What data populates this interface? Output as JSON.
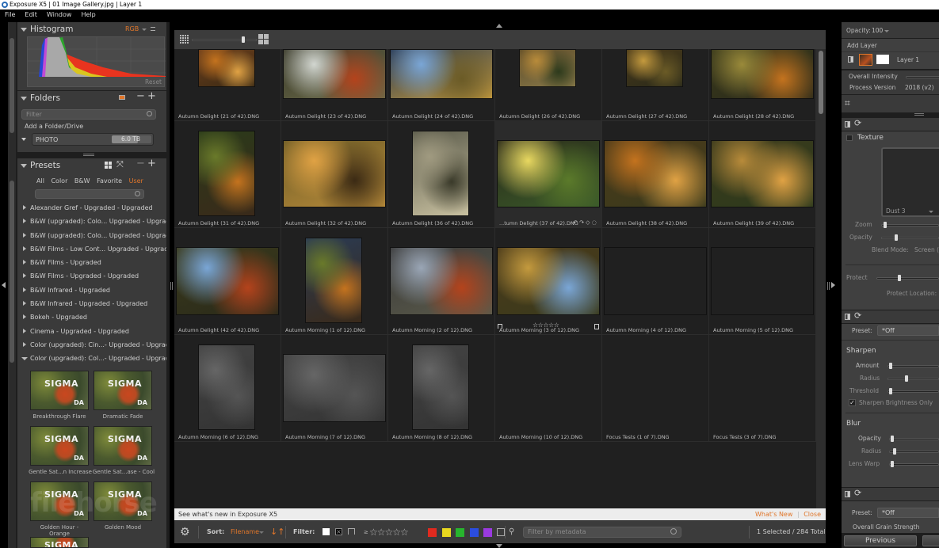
{
  "window": {
    "title": "Exposure X5 | 01 Image Gallery.jpg | Layer 1"
  },
  "menu": [
    "File",
    "Edit",
    "Window",
    "Help"
  ],
  "left_panel": {
    "histogram": {
      "title": "Histogram",
      "channel": "RGB",
      "reset_label": "Reset"
    },
    "folders": {
      "title": "Folders",
      "filter_placeholder": "Filter",
      "add_label": "Add a Folder/Drive",
      "drive": {
        "name": "PHOTO",
        "size": "6.0 TB",
        "used_fraction": 0.65
      }
    },
    "presets": {
      "title": "Presets",
      "tabs": [
        "All",
        "Color",
        "B&W",
        "Favorite",
        "User"
      ],
      "active_tab": "User",
      "items": [
        "Alexander Gref - Upgraded - Upgraded",
        "B&W (upgraded): Colo... Upgraded - Upgraded",
        "B&W (upgraded): Colo... Upgraded - Upgraded",
        "B&W Films - Low Cont... Upgraded - Upgraded",
        "B&W Films - Upgraded",
        "B&W Films - Upgraded - Upgraded",
        "B&W Infrared - Upgraded",
        "B&W Infrared - Upgraded - Upgraded",
        "Bokeh - Upgraded",
        "Cinema - Upgraded - Upgraded",
        "Color (upgraded): Cin...- Upgraded - Upgraded",
        "Color (upgraded): Col...- Upgraded - Upgraded"
      ],
      "thumb_text": {
        "brand": "SIGMA",
        "badge": "DA"
      },
      "thumbnails": [
        "Breakthrough Flare",
        "Dramatic Fade",
        "Gentle Sat...n Increase",
        "Gentle Sat...ase - Cool",
        "Golden Hour - Orange",
        "Golden Mood",
        ""
      ]
    }
  },
  "center": {
    "thumb_size_fraction": 0.8,
    "rows": [
      [
        "Autumn Delight (21 of 42).DNG",
        "Autumn Delight (23 of 42).DNG",
        "Autumn Delight (24 of 42).DNG",
        "Autumn Delight (26 of 42).DNG",
        "Autumn Delight (27 of 42).DNG",
        "Autumn Delight (28 of 42).DNG"
      ],
      [
        "Autumn Delight (31 of 42).DNG",
        "Autumn Delight (32 of 42).DNG",
        "Autumn Delight (36 of 42).DNG",
        "...tumn Delight (37 of 42).DNG",
        "Autumn Delight (38 of 42).DNG",
        "Autumn Delight (39 of 42).DNG"
      ],
      [
        "Autumn Delight (42 of 42).DNG",
        "Autumn Morning (1 of 12).DNG",
        "Autumn Morning (2 of 12).DNG",
        "Autumn Morning (3 of 12).DNG",
        "Autumn Morning (4 of 12).DNG",
        "Autumn Morning (5 of 12).DNG"
      ],
      [
        "Autumn Morning (6 of 12).DNG",
        "Autumn Morning (7 of 12).DNG",
        "Autumn Morning (8 of 12).DNG",
        "Autumn Morning (10 of 12).DNG",
        "Focus Tests (1 of 7).DNG",
        "Focus Tests (3 of 7).DNG"
      ]
    ],
    "selected": "Autumn Delight (37 of 42).DNG",
    "selected_rating": 0,
    "notice": {
      "text": "See what's new in Exposure X5",
      "whats_new": "What's New",
      "close": "Close"
    },
    "bottom": {
      "sort_label": "Sort:",
      "sort_value": "Filename",
      "filter_label": "Filter:",
      "rating_prefix": "≥",
      "color_labels": [
        "#e02a1f",
        "#e8d81f",
        "#27b52e",
        "#2b4de0",
        "#9a3ae0"
      ],
      "metadata_placeholder": "Filter by metadata",
      "count": "1 Selected / 284 Total"
    }
  },
  "right_panel": {
    "opacity_label": "Opacity:",
    "opacity_value": "100",
    "add_layer": "Add Layer",
    "layer_name": "Layer 1",
    "overall_intensity": "Overall Intensity",
    "process_version_label": "Process Version",
    "process_version_value": "2018 (v2)",
    "texture": {
      "title": "Texture",
      "texture_name": "Dust 3",
      "zoom": "Zoom",
      "opacity": "Opacity",
      "blend_label": "Blend Mode:",
      "blend_value": "Screen (B",
      "protect": "Protect",
      "protect_location": "Protect Location:"
    },
    "sharpen_section": {
      "preset_label": "Preset:",
      "preset_value": "*Off",
      "title": "Sharpen",
      "amount": "Amount",
      "radius": "Radius",
      "threshold": "Threshold",
      "brightness_only": "Sharpen Brightness Only",
      "blur_title": "Blur",
      "blur_opacity": "Opacity",
      "blur_radius": "Radius",
      "lens_warp": "Lens Warp"
    },
    "grain": {
      "preset_label": "Preset:",
      "preset_value": "*Off",
      "overall": "Overall Grain Strength"
    },
    "previous_button": "Previous"
  }
}
